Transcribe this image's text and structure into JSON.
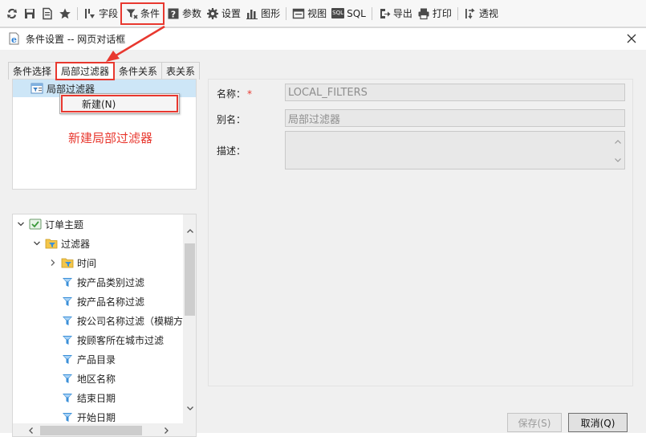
{
  "toolbar": {
    "items": [
      {
        "icon": "refresh-icon",
        "label": ""
      },
      {
        "icon": "save-icon",
        "label": ""
      },
      {
        "icon": "document-icon",
        "label": ""
      },
      {
        "icon": "star-icon",
        "label": ""
      },
      {
        "icon": "field-icon",
        "label": "字段"
      },
      {
        "icon": "filter-icon",
        "label": "条件"
      },
      {
        "icon": "question-icon",
        "label": "参数"
      },
      {
        "icon": "gear-icon",
        "label": "设置"
      },
      {
        "icon": "bar-chart-icon",
        "label": "图形"
      },
      {
        "icon": "view-icon",
        "label": "视图"
      },
      {
        "icon": "sql-icon",
        "label": "SQL",
        "badge": "SQL"
      },
      {
        "icon": "export-icon",
        "label": "导出"
      },
      {
        "icon": "print-icon",
        "label": "打印"
      },
      {
        "icon": "pivot-icon",
        "label": "透视"
      }
    ]
  },
  "dialog": {
    "title": "条件设置 -- 网页对话框",
    "tabs": [
      "条件选择",
      "局部过滤器",
      "条件关系",
      "表关系"
    ],
    "active_tab": "局部过滤器"
  },
  "left_top": {
    "node_label": "局部过滤器",
    "context_menu_item": "新建(N)",
    "annotation": "新建局部过滤器"
  },
  "tree": {
    "root": "订单主题",
    "folder": "过滤器",
    "subfolder": "时间",
    "items": [
      "按产品类别过滤",
      "按产品名称过滤",
      "按公司名称过滤（模糊方",
      "按顾客所在城市过滤",
      "产品目录",
      "地区名称",
      "结束日期",
      "开始日期"
    ]
  },
  "form": {
    "name_label": "名称：",
    "required_mark": "*",
    "name_value": "LOCAL_FILTERS",
    "alias_label": "别名：",
    "alias_value": "局部过滤器",
    "desc_label": "描述：",
    "desc_value": ""
  },
  "buttons": {
    "save": "保存(S)",
    "cancel": "取消(Q)"
  },
  "colors": {
    "highlight_red": "#e8382f",
    "selection_blue": "#cde6f7"
  }
}
